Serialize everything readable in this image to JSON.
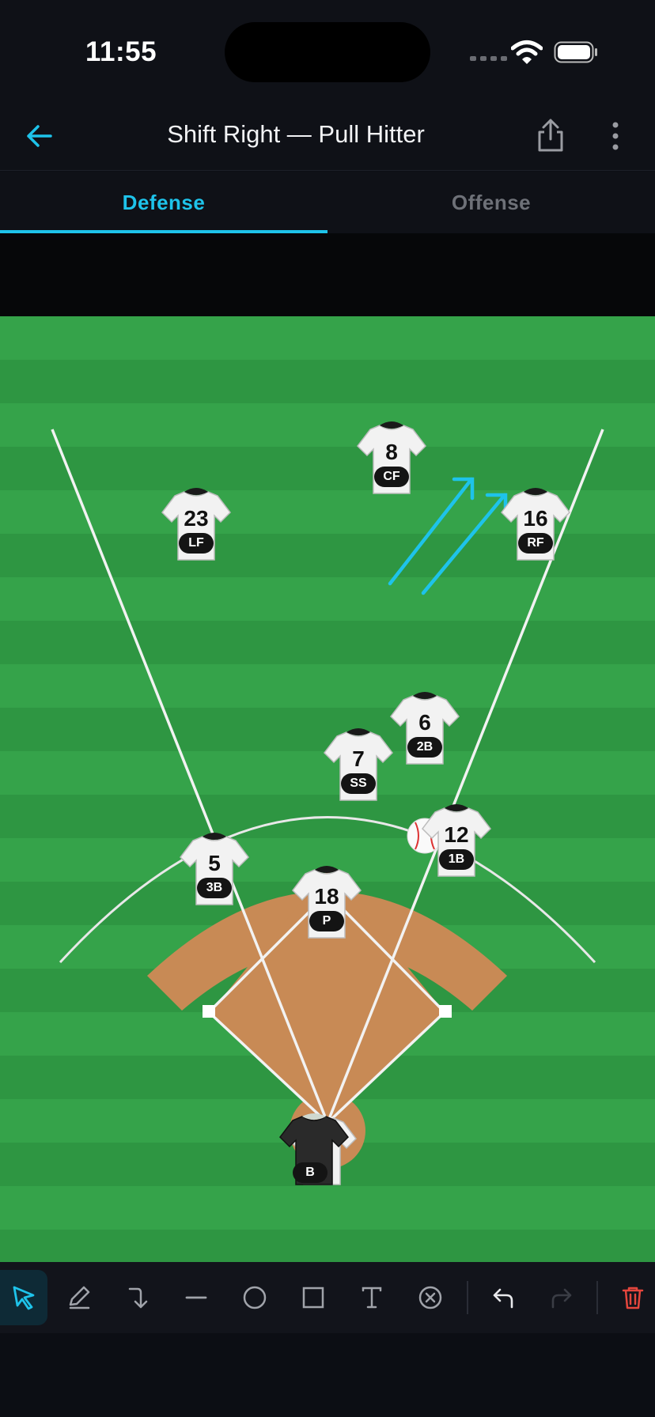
{
  "status_bar": {
    "time": "11:55"
  },
  "header": {
    "title": "Shift Right — Pull Hitter"
  },
  "tabs": [
    {
      "label": "Defense",
      "active": true
    },
    {
      "label": "Offense",
      "active": false
    }
  ],
  "colors": {
    "accent": "#1ec3ea",
    "grass": "#2f9a45",
    "infield_dirt": "#c88a55",
    "delete": "#e5463d"
  },
  "players": [
    {
      "number": "8",
      "position": "CF"
    },
    {
      "number": "23",
      "position": "LF"
    },
    {
      "number": "16",
      "position": "RF"
    },
    {
      "number": "6",
      "position": "2B"
    },
    {
      "number": "7",
      "position": "SS"
    },
    {
      "number": "12",
      "position": "1B"
    },
    {
      "number": "5",
      "position": "3B"
    },
    {
      "number": "18",
      "position": "P"
    }
  ],
  "batter": {
    "position": "B"
  },
  "toolbar": {
    "tools": [
      {
        "name": "select-tool",
        "icon": "cursor-icon",
        "active": true
      },
      {
        "name": "pen-tool",
        "icon": "pencil-icon"
      },
      {
        "name": "arrow-tool",
        "icon": "curved-arrow-icon"
      },
      {
        "name": "line-tool",
        "icon": "line-icon"
      },
      {
        "name": "circle-tool",
        "icon": "circle-icon"
      },
      {
        "name": "rectangle-tool",
        "icon": "square-icon"
      },
      {
        "name": "text-tool",
        "icon": "text-icon"
      },
      {
        "name": "erase-tool",
        "icon": "x-circle-icon"
      },
      {
        "name": "undo",
        "icon": "undo-icon"
      },
      {
        "name": "redo",
        "icon": "redo-icon"
      },
      {
        "name": "delete",
        "icon": "trash-icon"
      }
    ]
  }
}
